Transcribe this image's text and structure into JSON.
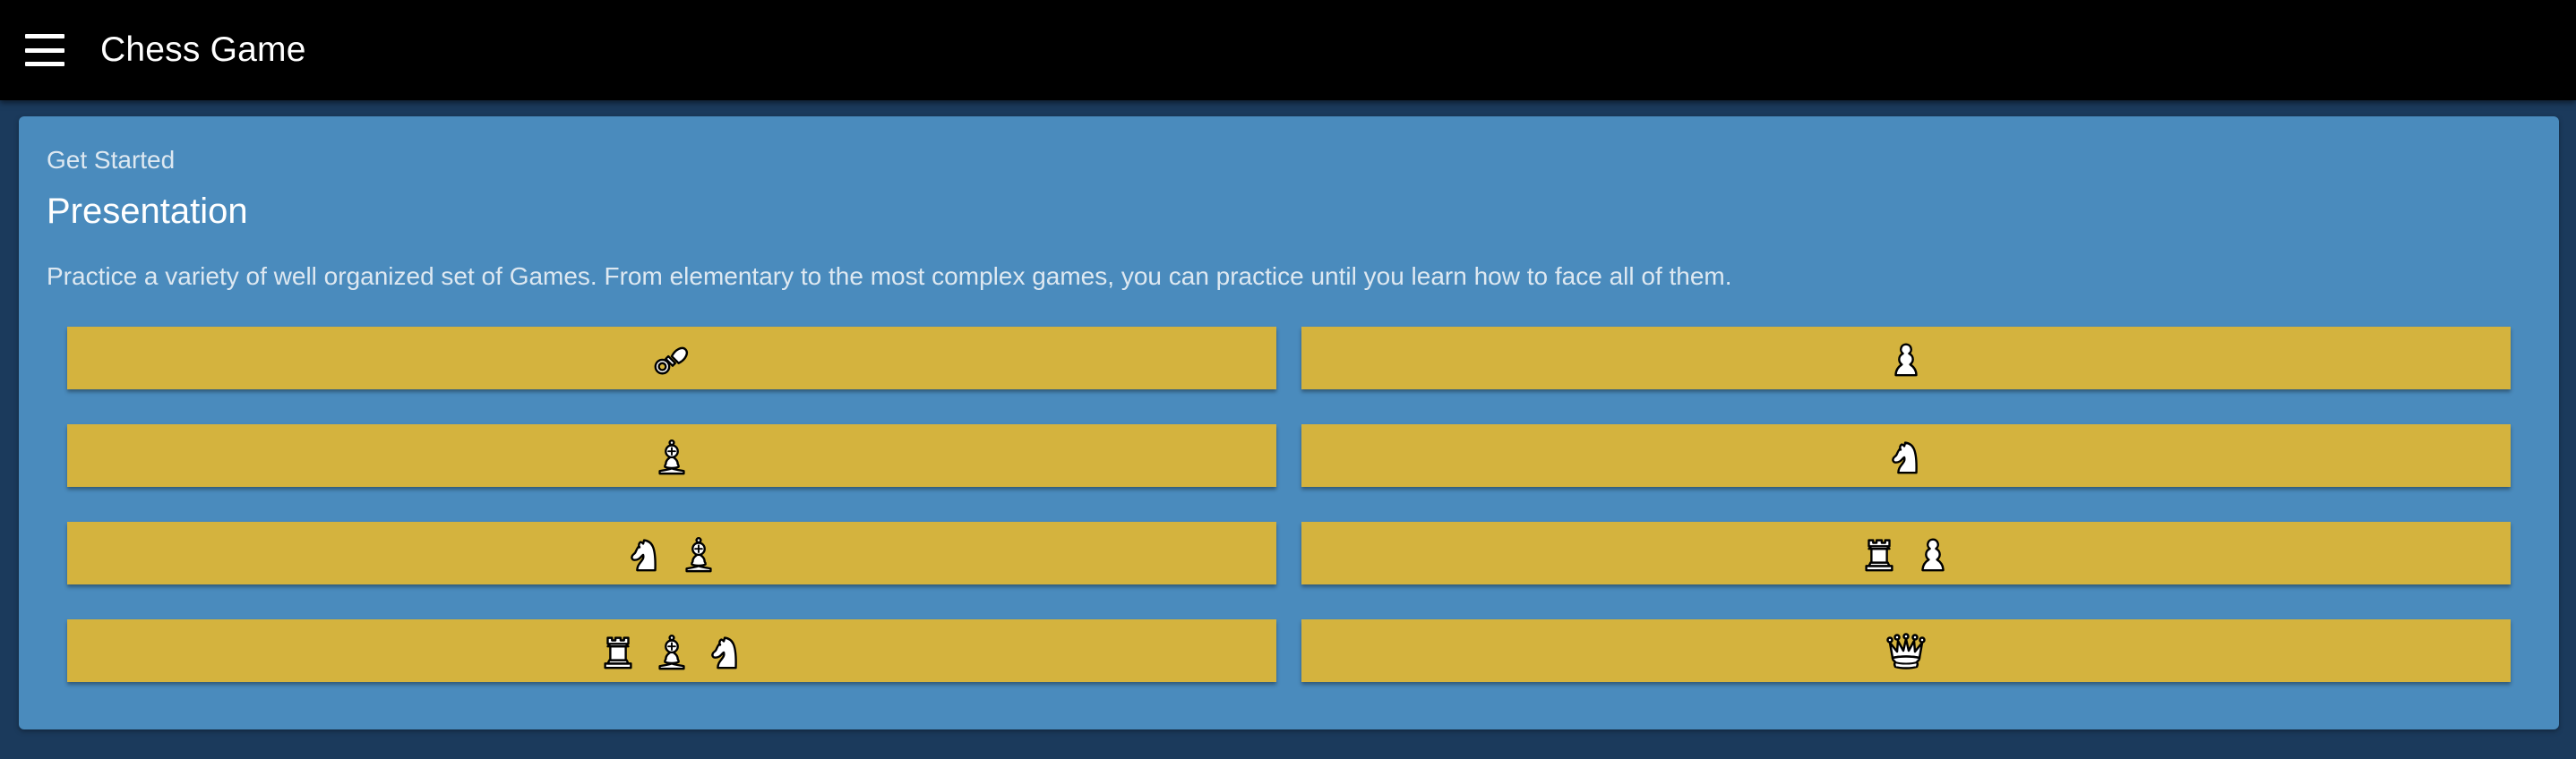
{
  "app": {
    "title": "Chess Game"
  },
  "card": {
    "overline": "Get Started",
    "title": "Presentation",
    "description": "Practice a variety of well organized set of Games. From elementary to the most complex games, you can practice until you learn how to face all of them."
  },
  "levels": [
    {
      "icons": [
        "pacifier-icon"
      ]
    },
    {
      "icons": [
        "pawn-icon"
      ]
    },
    {
      "icons": [
        "bishop-icon"
      ]
    },
    {
      "icons": [
        "knight-icon"
      ]
    },
    {
      "icons": [
        "knight-icon",
        "bishop-icon"
      ]
    },
    {
      "icons": [
        "rook-icon",
        "pawn-icon"
      ]
    },
    {
      "icons": [
        "rook-icon",
        "bishop-icon",
        "knight-icon"
      ]
    },
    {
      "icons": [
        "queen-icon"
      ]
    }
  ],
  "colors": {
    "appbar": "#000000",
    "background": "#1b3a5c",
    "card": "#4a8bbd",
    "button": "#d4b33e"
  }
}
